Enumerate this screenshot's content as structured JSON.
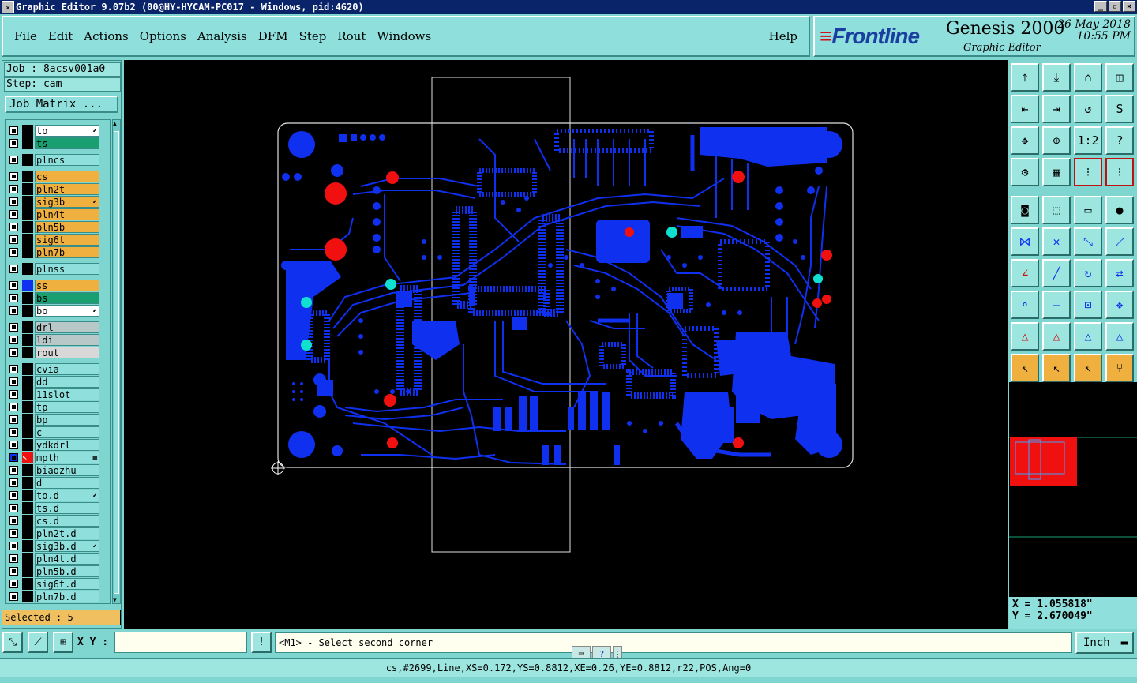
{
  "window": {
    "title": "Graphic Editor 9.07b2 (00@HY-HYCAM-PC017 - Windows, pid:4620)"
  },
  "menu": {
    "items": [
      "File",
      "Edit",
      "Actions",
      "Options",
      "Analysis",
      "DFM",
      "Step",
      "Rout",
      "Windows"
    ],
    "help": "Help"
  },
  "brand": {
    "logo": "Frontline",
    "product": "Genesis 2000",
    "subtitle": "Graphic Editor",
    "date": "26 May 2018",
    "time": "10:55 PM"
  },
  "job": {
    "job_label": "Job : 8acsv001a0",
    "step_label": "Step: cam",
    "matrix_button": "Job Matrix ..."
  },
  "layers": [
    {
      "name": "to",
      "color": "#ffffff",
      "mark": "⬋"
    },
    {
      "name": "ts",
      "color": "#1aa070",
      "mark": ""
    },
    {
      "name": "plncs",
      "color": "#8fe0dc",
      "mark": ""
    },
    {
      "name": "cs",
      "color": "#f0b040",
      "mark": ""
    },
    {
      "name": "pln2t",
      "color": "#f0b040",
      "mark": ""
    },
    {
      "name": "sig3b",
      "color": "#f0b040",
      "mark": "⬋"
    },
    {
      "name": "pln4t",
      "color": "#f0b040",
      "mark": ""
    },
    {
      "name": "pln5b",
      "color": "#f0b040",
      "mark": ""
    },
    {
      "name": "sig6t",
      "color": "#f0b040",
      "mark": ""
    },
    {
      "name": "pln7b",
      "color": "#f0b040",
      "mark": ""
    },
    {
      "name": "plnss",
      "color": "#8fe0dc",
      "mark": ""
    },
    {
      "name": "ss",
      "color": "#f0b040",
      "mark": ""
    },
    {
      "name": "bs",
      "color": "#1aa070",
      "mark": ""
    },
    {
      "name": "bo",
      "color": "#ffffff",
      "mark": "⬋"
    },
    {
      "name": "drl",
      "color": "#b8c8c8",
      "mark": ""
    },
    {
      "name": "ldi",
      "color": "#b8c8c8",
      "mark": ""
    },
    {
      "name": "rout",
      "color": "#d8d8d8",
      "mark": ""
    },
    {
      "name": "cvia",
      "color": "#8fe0dc",
      "mark": ""
    },
    {
      "name": "dd",
      "color": "#8fe0dc",
      "mark": ""
    },
    {
      "name": "11slot",
      "color": "#8fe0dc",
      "mark": ""
    },
    {
      "name": "tp",
      "color": "#8fe0dc",
      "mark": ""
    },
    {
      "name": "bp",
      "color": "#8fe0dc",
      "mark": ""
    },
    {
      "name": "c",
      "color": "#8fe0dc",
      "mark": ""
    },
    {
      "name": "ydkdrl",
      "color": "#8fe0dc",
      "mark": ""
    },
    {
      "name": "mpth",
      "color": "#8fe0dc",
      "mark": "▦"
    },
    {
      "name": "biaozhu",
      "color": "#8fe0dc",
      "mark": ""
    },
    {
      "name": "d",
      "color": "#8fe0dc",
      "mark": ""
    },
    {
      "name": "to.d",
      "color": "#8fe0dc",
      "mark": "⬋"
    },
    {
      "name": "ts.d",
      "color": "#8fe0dc",
      "mark": ""
    },
    {
      "name": "cs.d",
      "color": "#8fe0dc",
      "mark": ""
    },
    {
      "name": "pln2t.d",
      "color": "#8fe0dc",
      "mark": ""
    },
    {
      "name": "sig3b.d",
      "color": "#8fe0dc",
      "mark": "⬋"
    },
    {
      "name": "pln4t.d",
      "color": "#8fe0dc",
      "mark": ""
    },
    {
      "name": "pln5b.d",
      "color": "#8fe0dc",
      "mark": ""
    },
    {
      "name": "sig6t.d",
      "color": "#8fe0dc",
      "mark": ""
    },
    {
      "name": "pln7b.d",
      "color": "#8fe0dc",
      "mark": ""
    }
  ],
  "selected": "Selected : 5",
  "coords": {
    "x": "X = 1.055818\"",
    "y": "Y = 2.670049\""
  },
  "bottom": {
    "xy_label": "X Y :",
    "prompt": "<M1> - Select second corner",
    "unit": "Inch"
  },
  "status": "cs,#2699,Line,XS=0.172,YS=0.8812,XE=0.26,YE=0.8812,r22,POS,Ang=0",
  "colors": {
    "board": "#1030f0",
    "highlight_red": "#f01010",
    "highlight_cyan": "#10e0d0"
  }
}
